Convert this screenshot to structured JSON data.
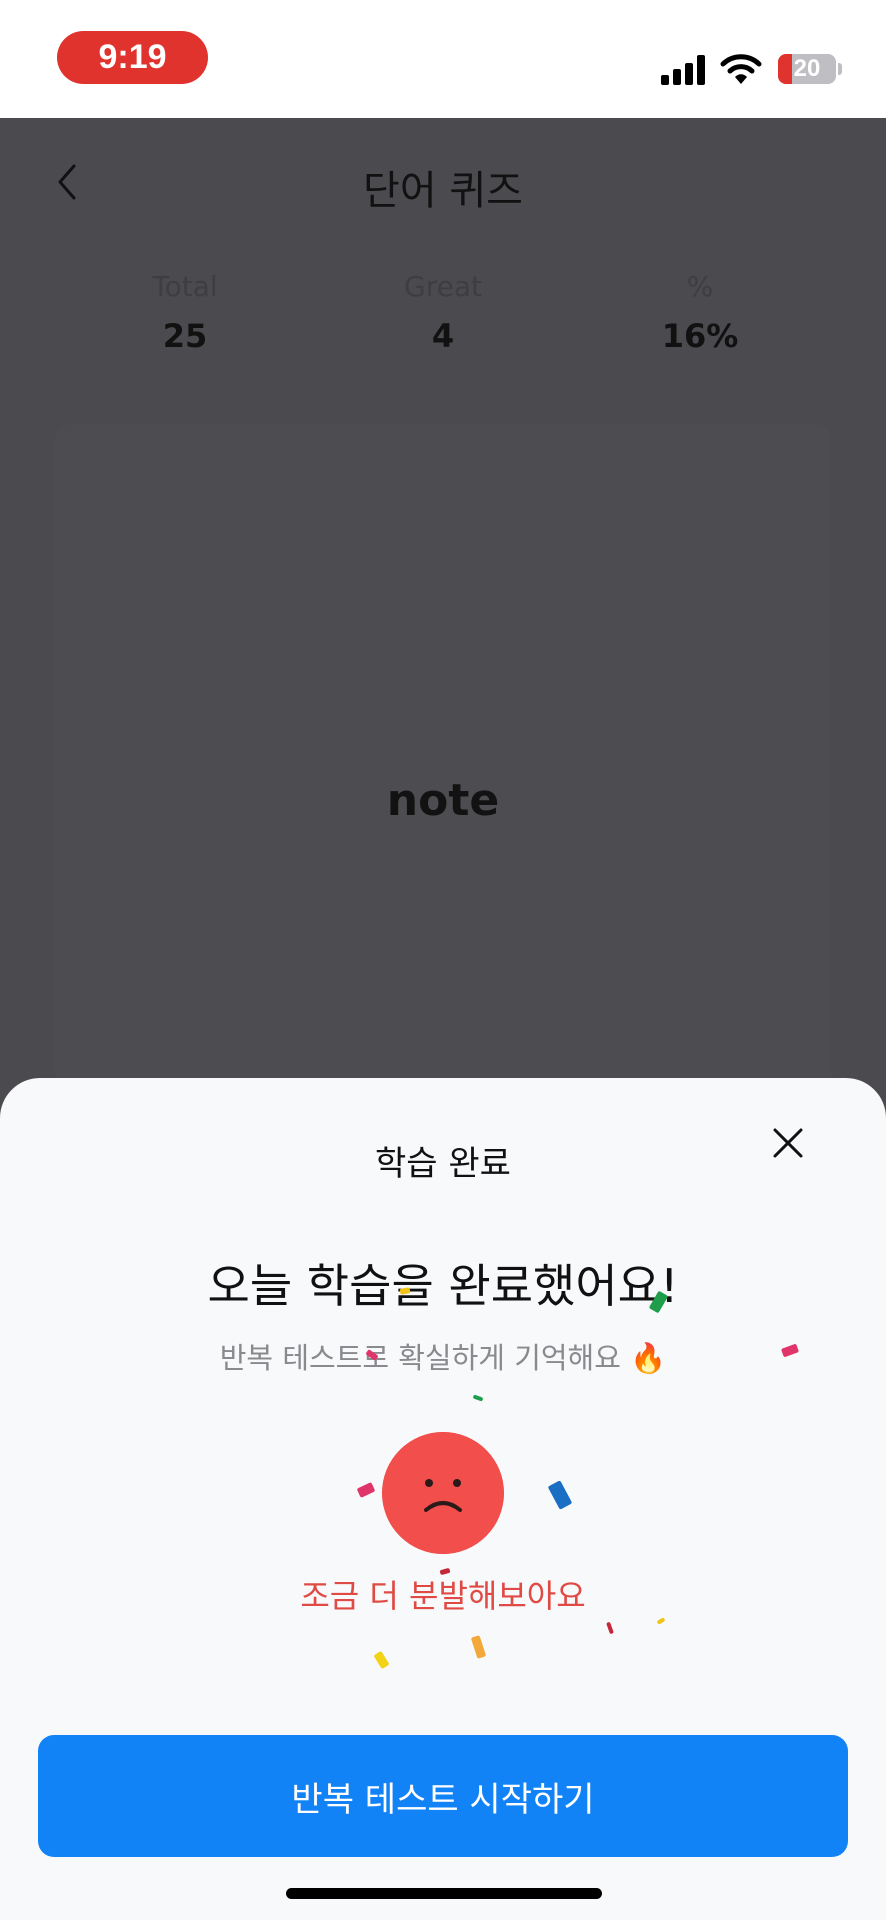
{
  "status_bar": {
    "time": "9:19",
    "battery_percent": "20",
    "icons": [
      "signal-icon",
      "wifi-icon",
      "battery-icon"
    ]
  },
  "nav": {
    "title": "단어 퀴즈",
    "back_icon": "chevron-left-icon"
  },
  "stats": [
    {
      "label": "Total",
      "value": "25"
    },
    {
      "label": "Great",
      "value": "4"
    },
    {
      "label": "%",
      "value": "16%"
    }
  ],
  "card": {
    "word": "note"
  },
  "sheet": {
    "title": "학습 완료",
    "close_icon": "close-icon",
    "headline": "오늘 학습을 완료했어요!",
    "subtitle": "반복 테스트로 확실하게 기억해요 🔥",
    "face_icon": "sad-face-icon",
    "result": "조금 더 분발해보아요",
    "cta_label": "반복 테스트 시작하기"
  },
  "colors": {
    "accent": "#1283f7",
    "alert": "#e0332e",
    "face": "#f14e4c",
    "dim_background": "#4b4a4e"
  }
}
